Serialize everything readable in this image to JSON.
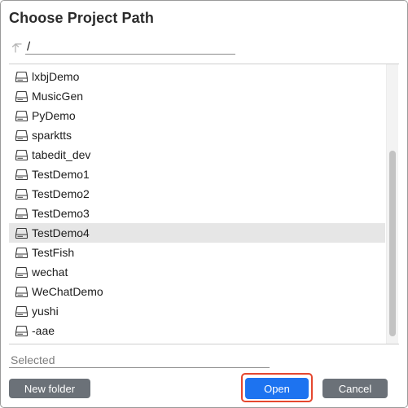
{
  "dialog": {
    "title": "Choose Project Path"
  },
  "path": {
    "value": "/",
    "up_icon": "up-arrow-icon"
  },
  "list": {
    "item_icon": "drive-icon",
    "items": [
      {
        "label": "lxbjDemo",
        "selected": false
      },
      {
        "label": "MusicGen",
        "selected": false
      },
      {
        "label": "PyDemo",
        "selected": false
      },
      {
        "label": "sparktts",
        "selected": false
      },
      {
        "label": "tabedit_dev",
        "selected": false
      },
      {
        "label": "TestDemo1",
        "selected": false
      },
      {
        "label": "TestDemo2",
        "selected": false
      },
      {
        "label": "TestDemo3",
        "selected": false
      },
      {
        "label": "TestDemo4",
        "selected": true
      },
      {
        "label": "TestFish",
        "selected": false
      },
      {
        "label": "wechat",
        "selected": false
      },
      {
        "label": "WeChatDemo",
        "selected": false
      },
      {
        "label": "yushi",
        "selected": false
      },
      {
        "label": "-aae",
        "selected": false
      }
    ]
  },
  "selected_field": {
    "placeholder": "Selected",
    "value": ""
  },
  "buttons": {
    "new_folder": "New folder",
    "open": "Open",
    "cancel": "Cancel"
  },
  "colors": {
    "primary": "#1d73f0",
    "secondary": "#6b7178",
    "highlight": "#e5472f",
    "selected_row": "#e6e6e6"
  }
}
